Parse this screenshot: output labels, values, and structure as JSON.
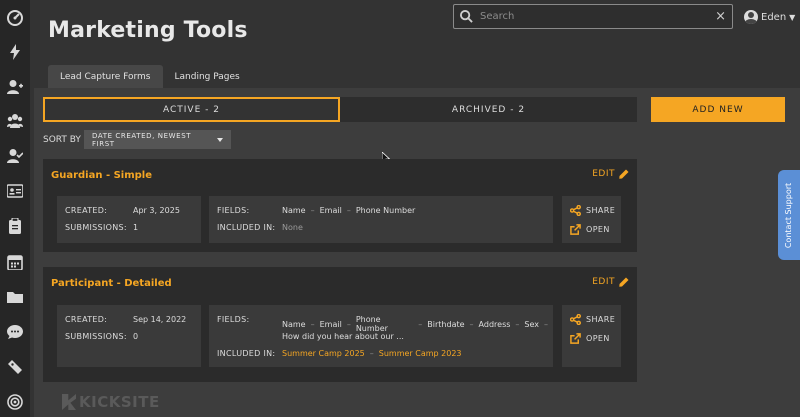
{
  "page": {
    "title": "Marketing Tools"
  },
  "search": {
    "placeholder": "Search",
    "clear_label": "×"
  },
  "user": {
    "name": "Eden"
  },
  "tabs": [
    {
      "label": "Lead Capture Forms",
      "active": true
    },
    {
      "label": "Landing Pages",
      "active": false
    }
  ],
  "filter": {
    "active_label": "ACTIVE - 2",
    "archived_label": "ARCHIVED - 2"
  },
  "add_new_label": "ADD NEW",
  "sort": {
    "label": "SORT BY",
    "value": "DATE CREATED, NEWEST FIRST"
  },
  "forms": [
    {
      "title": "Guardian - Simple",
      "edit_label": "EDIT",
      "created_label": "CREATED:",
      "created": "Apr 3, 2025",
      "submissions_label": "SUBMISSIONS:",
      "submissions": "1",
      "fields_label": "FIELDS:",
      "fields": [
        "Name",
        "Email",
        "Phone Number"
      ],
      "included_label": "INCLUDED IN:",
      "included": [
        "None"
      ],
      "share_label": "SHARE",
      "open_label": "OPEN"
    },
    {
      "title": "Participant - Detailed",
      "edit_label": "EDIT",
      "created_label": "CREATED:",
      "created": "Sep 14, 2022",
      "submissions_label": "SUBMISSIONS:",
      "submissions": "0",
      "fields_label": "FIELDS:",
      "fields": [
        "Name",
        "Email",
        "Phone Number",
        "Birthdate",
        "Address",
        "Sex"
      ],
      "fields_line2": "How did you hear about our ...",
      "included_label": "INCLUDED IN:",
      "included": [
        "Summer Camp 2025",
        "Summer Camp 2023"
      ],
      "share_label": "SHARE",
      "open_label": "OPEN"
    }
  ],
  "brand": {
    "name": "KICKSITE"
  },
  "contact_support": "Contact Support",
  "colors": {
    "accent": "#f5a623",
    "background": "#333333",
    "sidebar": "#262626",
    "support": "#5b8fd6"
  },
  "sidebar_icons": [
    "dashboard-icon",
    "lightning-icon",
    "add-user-icon",
    "group-icon",
    "user-check-icon",
    "id-card-icon",
    "clipboard-icon",
    "calendar-icon",
    "folder-icon",
    "chat-icon",
    "ticket-icon",
    "target-icon"
  ]
}
